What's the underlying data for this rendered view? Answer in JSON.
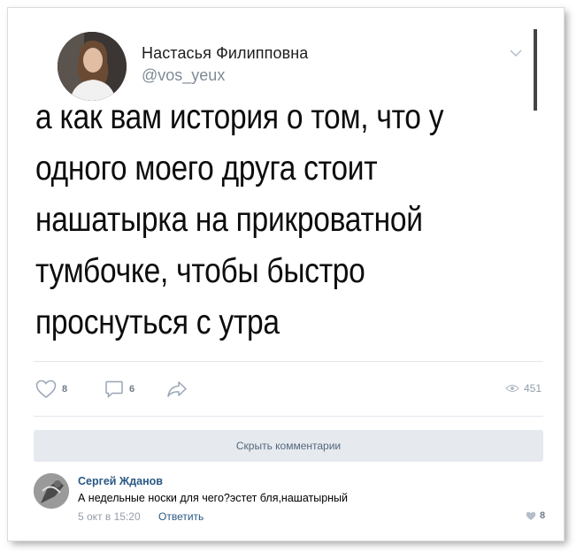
{
  "post": {
    "author_name": "Настасья Филипповна",
    "author_handle": "@vos_yeux",
    "text": "а как вам история о том, что у\nодного моего друга стоит\nнашатырка на прикроватной\nтумбочке, чтобы быстро\nпроснуться с утра",
    "likes": "8",
    "comments": "6",
    "views": "451",
    "menu_icon": "chevron-down-icon"
  },
  "comments_section": {
    "hide_label": "Скрыть комментарии",
    "items": [
      {
        "author": "Сергей Жданов",
        "text": "А недельные носки для чего?эстет бля,нашатырный",
        "date": "5 окт в 15:20",
        "reply_label": "Ответить",
        "likes": "8"
      }
    ]
  },
  "colors": {
    "link": "#2a5885",
    "muted": "#939ea9",
    "button_bg": "#e6eaef"
  }
}
